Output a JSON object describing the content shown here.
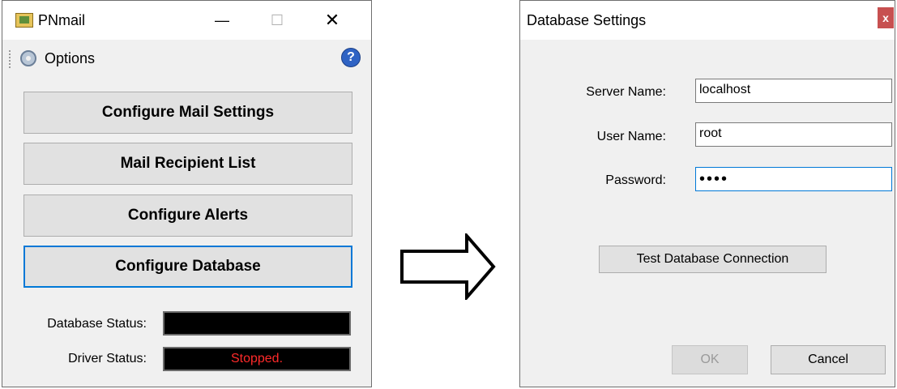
{
  "main_window": {
    "title": "PNmail",
    "minimize_glyph": "—",
    "maximize_glyph": "☐",
    "close_glyph": "✕",
    "menu": {
      "options_label": "Options",
      "help_glyph": "?"
    },
    "buttons": [
      "Configure Mail Settings",
      "Mail Recipient List",
      "Configure Alerts",
      "Configure Database"
    ],
    "status": {
      "database_label": "Database Status:",
      "database_value": "",
      "driver_label": "Driver Status:",
      "driver_value": "Stopped.",
      "driver_value_color": "#ff2a2a"
    }
  },
  "dialog": {
    "title": "Database Settings",
    "close_glyph": "x",
    "server_label": "Server Name:",
    "server_value": "localhost",
    "user_label": "User Name:",
    "user_value": "root",
    "password_label": "Password:",
    "password_value": "••••",
    "test_button": "Test Database Connection",
    "ok_button": "OK",
    "cancel_button": "Cancel"
  },
  "colors": {
    "focus_accent": "#0078d7",
    "close_red": "#c75050"
  }
}
